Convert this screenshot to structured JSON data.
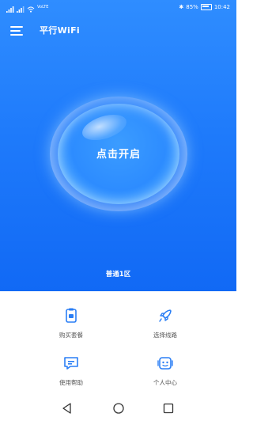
{
  "status_bar": {
    "network_info": "VoLTE",
    "battery_percent": "85%",
    "time": "10:42"
  },
  "header": {
    "title": "平行WiFi"
  },
  "connect": {
    "button_label": "点击开启",
    "region_label": "普通1区"
  },
  "grid": {
    "items": [
      {
        "label": "购买套餐",
        "icon": "package-icon"
      },
      {
        "label": "选择线路",
        "icon": "rocket-icon"
      },
      {
        "label": "使用帮助",
        "icon": "chat-help-icon"
      },
      {
        "label": "个人中心",
        "icon": "profile-icon"
      }
    ]
  },
  "colors": {
    "primary": "#1f7bfb",
    "icon_blue": "#2a7ef5",
    "text_gray": "#555555"
  },
  "nav": {
    "back_icon": "triangle-back-icon",
    "home_icon": "circle-home-icon",
    "recents_icon": "square-recents-icon"
  }
}
